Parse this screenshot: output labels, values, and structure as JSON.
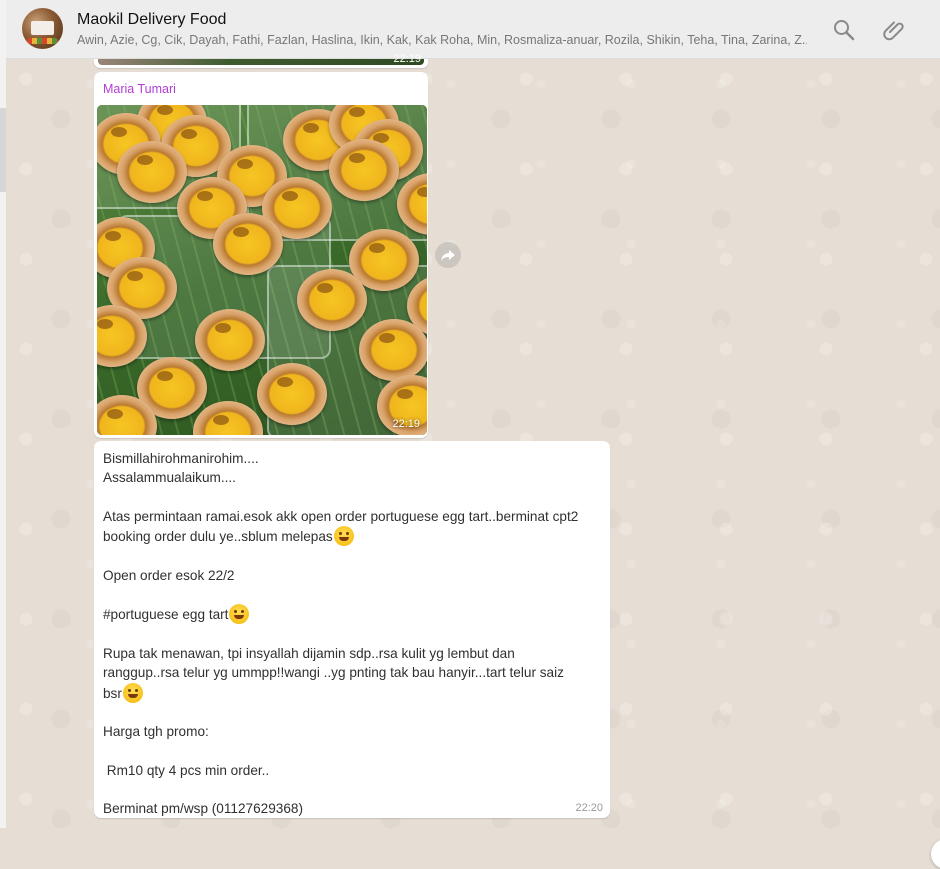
{
  "header": {
    "title": "Maokil Delivery Food",
    "members": "Awin, Azie, Cg, Cik, Dayah, Fathi, Fazlan, Haslina, Ikin, Kak, Kak Roha, Min, Rosmaliza-anuar, Rozila, Shikin, Teha, Tina, Zarina, Z...",
    "icons": [
      "search-icon",
      "paperclip-icon"
    ]
  },
  "messages": {
    "previous_time": "22:19",
    "image_message": {
      "sender": "Maria Tumari",
      "time": "22:19"
    },
    "text_message": {
      "lines": [
        "Bismillahirohmanirohim....",
        "Assalammualaikum....",
        "",
        "Atas permintaan ramai.esok akk open order portuguese egg tart..berminat cpt2",
        "booking order dulu ye..sblum melepas",
        "",
        "Open order esok 22/2",
        "",
        "#portuguese egg tart",
        "",
        "Rupa tak menawan, tpi insyallah dijamin sdp..rsa kulit yg lembut dan",
        "ranggup..rsa telur yg ummpp!!wangi ..yg pnting tak bau hanyir...tart telur saiz",
        "bsr",
        "",
        "Harga tgh promo:",
        "",
        " Rm10 qty 4 pcs min order..",
        "",
        "Berminat pm/wsp (01127629368)"
      ],
      "time": "22:20"
    }
  },
  "colors": {
    "sender_name": "#b23ed6",
    "chat_background": "#e6ded5",
    "header_background": "#ededed"
  }
}
